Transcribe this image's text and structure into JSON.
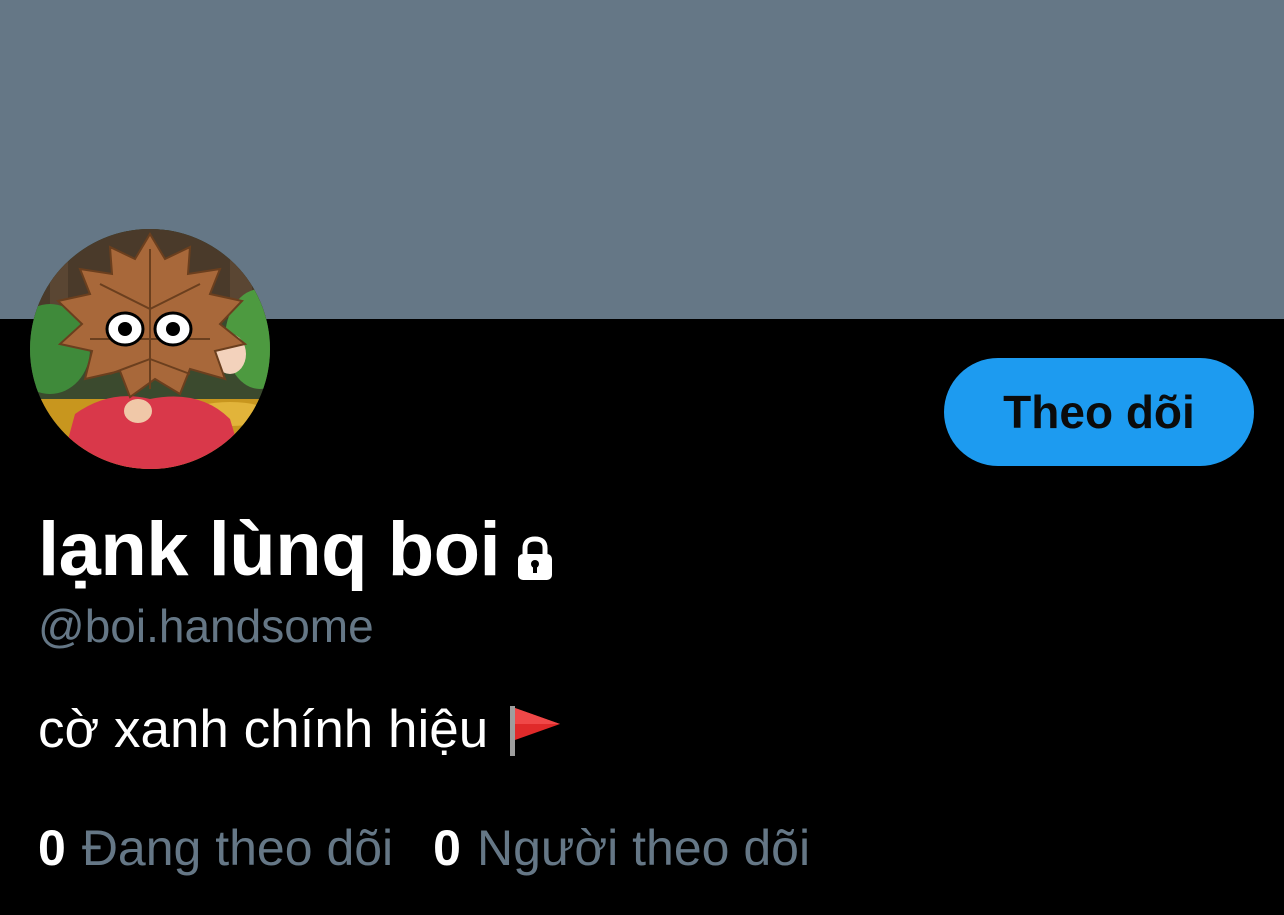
{
  "profile": {
    "display_name": "lạnk lùnq boi",
    "handle": "@boi.handsome",
    "bio": "cờ xanh chính hiệu",
    "bio_emoji": "red-flag-icon",
    "locked": true,
    "banner_color": "#657786",
    "avatar_desc": "cartoon-avatar"
  },
  "actions": {
    "follow_label": "Theo dõi",
    "follow_color": "#1D9BF0"
  },
  "stats": {
    "following_count": "0",
    "following_label": "Đang theo dõi",
    "followers_count": "0",
    "followers_label": "Người theo dõi"
  },
  "colors": {
    "background": "#000000",
    "primary_text": "#ffffff",
    "secondary_text": "#657786"
  }
}
